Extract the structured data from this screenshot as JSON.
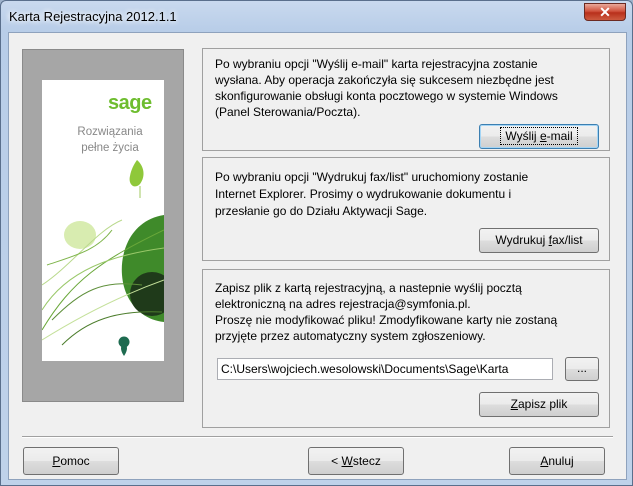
{
  "window": {
    "title": "Karta Rejestracyjna 2012.1.1",
    "close_label": "✕"
  },
  "banner": {
    "logo": "sage",
    "slogan_line1": "Rozwiązania",
    "slogan_line2": "pełne życia"
  },
  "email_section": {
    "line1": "Po wybraniu opcji \"Wyślij e-mail\" karta rejestracyjna zostanie",
    "line2": "wysłana. Aby operacja zakończyła się sukcesem niezbędne jest",
    "line3": "skonfigurowanie obsługi konta pocztowego w systemie Windows",
    "line4": "(Panel Sterowania/Poczta).",
    "button_pre": "Wyślij ",
    "button_key": "e",
    "button_post": "-mail"
  },
  "fax_section": {
    "line1": "Po wybraniu opcji \"Wydrukuj fax/list\" uruchomiony zostanie",
    "line2": "Internet Explorer. Prosimy o wydrukowanie dokumentu i",
    "line3": "przesłanie go do Działu Aktywacji Sage.",
    "button_pre": "Wydrukuj ",
    "button_key": "f",
    "button_post": "ax/list"
  },
  "save_section": {
    "line1": "Zapisz plik z kartą rejestracyjną, a nastepnie wyślij pocztą",
    "line2": "elektroniczną na adres rejestracja@symfonia.pl.",
    "line3": "Proszę nie modyfikować pliku! Zmodyfikowane karty nie zostaną",
    "line4": "przyjęte przez automatyczny system zgłoszeniowy.",
    "path_value": "C:\\Users\\wojciech.wesolowski\\Documents\\Sage\\Karta",
    "browse_label": "...",
    "button_key": "Z",
    "button_post": "apisz plik"
  },
  "footer": {
    "help_key": "P",
    "help_post": "omoc",
    "back_pre": "< ",
    "back_key": "W",
    "back_post": "stecz",
    "cancel_key": "A",
    "cancel_post": "nuluj"
  }
}
